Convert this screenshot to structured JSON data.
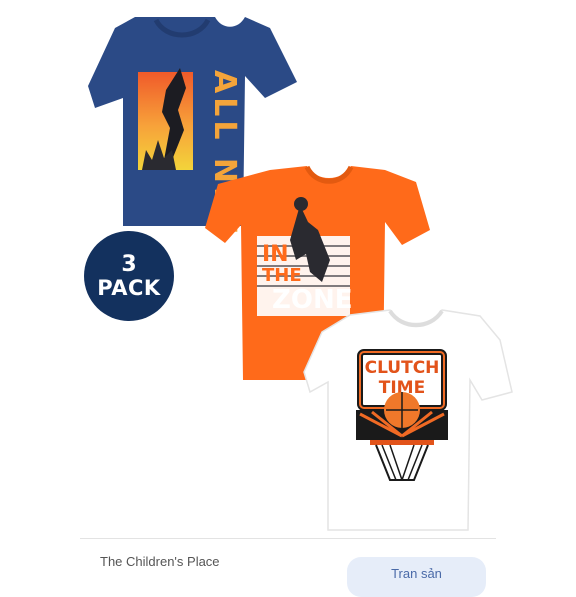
{
  "product": {
    "badge": {
      "count": "3",
      "text": "PACK"
    },
    "shirts": [
      {
        "color": "#2b4a86",
        "graphic_text": "ALL NET"
      },
      {
        "color": "#ff6a1a",
        "graphic_lines": [
          "IN",
          "THE",
          "ZONE"
        ]
      },
      {
        "color": "#ffffff",
        "graphic_lines": [
          "CLUTCH",
          "TIME"
        ]
      }
    ]
  },
  "listing": {
    "brand": "The Children's Place",
    "action_label": "Tran sản"
  }
}
